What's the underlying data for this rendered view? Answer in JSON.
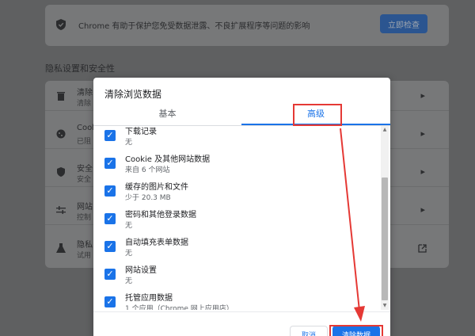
{
  "safety_check": {
    "text": "Chrome 有助于保护您免受数据泄露、不良扩展程序等问题的影响",
    "button": "立即检查"
  },
  "privacy_section": {
    "title": "隐私设置和安全性",
    "rows": [
      {
        "icon": "trash-icon",
        "t1": "清除",
        "t2": "清除"
      },
      {
        "icon": "cookie-icon",
        "t1": "Cook",
        "t2": "已阻"
      },
      {
        "icon": "shield-icon",
        "t1": "安全",
        "t2": "安全"
      },
      {
        "icon": "sliders-icon",
        "t1": "网站",
        "t2": "控制"
      },
      {
        "icon": "flask-icon",
        "t1": "隐私",
        "t2": "试用"
      }
    ]
  },
  "dialog": {
    "title": "清除浏览数据",
    "tabs": {
      "basic": "基本",
      "advanced": "高级"
    },
    "items": [
      {
        "label": "下载记录",
        "detail": "无"
      },
      {
        "label": "Cookie 及其他网站数据",
        "detail": "来自 6 个网站"
      },
      {
        "label": "缓存的图片和文件",
        "detail": "少于 20.3 MB"
      },
      {
        "label": "密码和其他登录数据",
        "detail": "无"
      },
      {
        "label": "自动填充表单数据",
        "detail": "无"
      },
      {
        "label": "网站设置",
        "detail": "无"
      },
      {
        "label": "托管应用数据",
        "detail": "1 个应用（Chrome 网上应用店）"
      }
    ],
    "cancel": "取消",
    "clear": "清除数据"
  },
  "colors": {
    "accent": "#1a73e8",
    "annotation": "#e53935"
  }
}
